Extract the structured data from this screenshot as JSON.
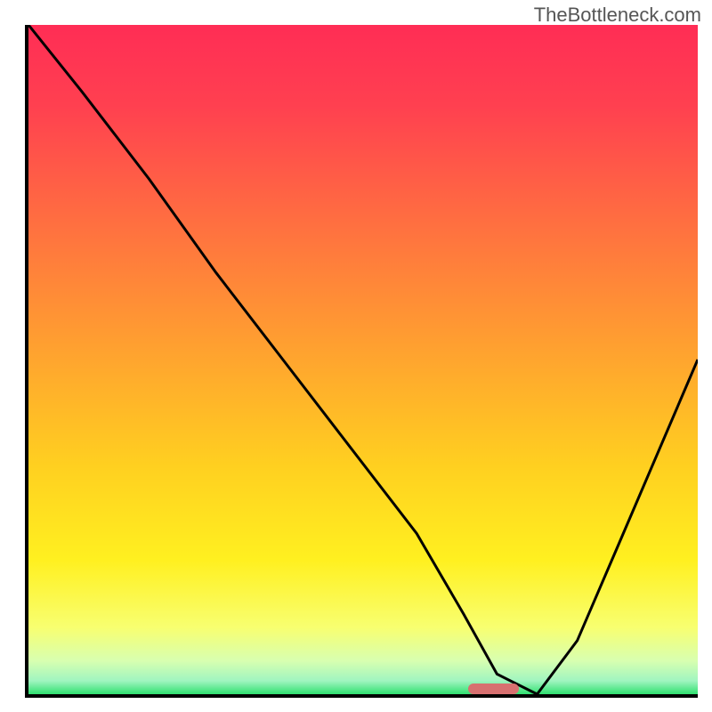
{
  "watermark": "TheBottleneck.com",
  "gradient": {
    "stops": [
      {
        "offset": "0%",
        "color": "#ff2d55"
      },
      {
        "offset": "12%",
        "color": "#ff4050"
      },
      {
        "offset": "30%",
        "color": "#ff7040"
      },
      {
        "offset": "48%",
        "color": "#ffa030"
      },
      {
        "offset": "66%",
        "color": "#ffd020"
      },
      {
        "offset": "80%",
        "color": "#fff020"
      },
      {
        "offset": "90%",
        "color": "#f8ff70"
      },
      {
        "offset": "95%",
        "color": "#d8ffb0"
      },
      {
        "offset": "98%",
        "color": "#a0f5c0"
      },
      {
        "offset": "100%",
        "color": "#30e070"
      }
    ]
  },
  "marker": {
    "x_frac": 0.695,
    "y_frac": 0.992,
    "w_frac": 0.075,
    "h_frac": 0.016
  },
  "chart_data": {
    "type": "line",
    "title": "",
    "xlabel": "",
    "ylabel": "",
    "xlim": [
      0,
      100
    ],
    "ylim": [
      0,
      100
    ],
    "x": [
      0,
      8,
      18,
      28,
      38,
      48,
      58,
      65,
      70,
      76,
      82,
      88,
      94,
      100
    ],
    "y": [
      100,
      90,
      77,
      63,
      50,
      37,
      24,
      12,
      3,
      0,
      8,
      22,
      36,
      50
    ],
    "marker_range_x": [
      69,
      77
    ],
    "note": "Values read by proportion from plot edges; no axis labels present in source image."
  }
}
